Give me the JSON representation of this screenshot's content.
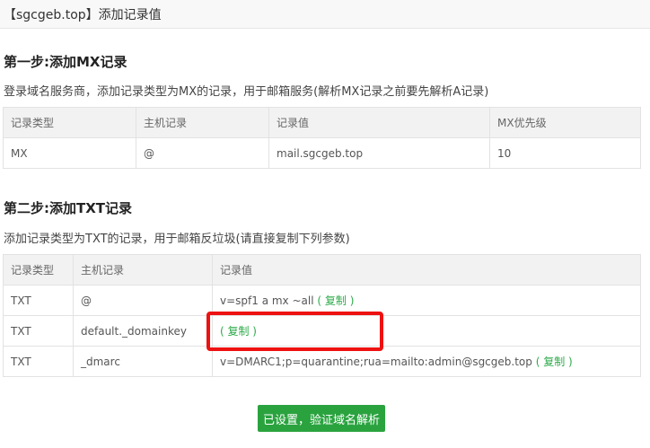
{
  "header": {
    "title": "【sgcgeb.top】添加记录值"
  },
  "step1": {
    "heading": "第一步:添加MX记录",
    "description": "登录域名服务商，添加记录类型为MX的记录，用于邮箱服务(解析MX记录之前要先解析A记录)",
    "columns": [
      "记录类型",
      "主机记录",
      "记录值",
      "MX优先级"
    ],
    "rows": [
      {
        "type": "MX",
        "host": "@",
        "value": "mail.sgcgeb.top",
        "priority": "10"
      }
    ]
  },
  "step2": {
    "heading": "第二步:添加TXT记录",
    "description": "添加记录类型为TXT的记录，用于邮箱反垃圾(请直接复制下列参数)",
    "columns": [
      "记录类型",
      "主机记录",
      "记录值"
    ],
    "rows": [
      {
        "type": "TXT",
        "host": "@",
        "value": "v=spf1 a mx ~all",
        "copy": "( 复制 )"
      },
      {
        "type": "TXT",
        "host": "default._domainkey",
        "value": "",
        "copy": "( 复制 )"
      },
      {
        "type": "TXT",
        "host": "_dmarc",
        "value": "v=DMARC1;p=quarantine;rua=mailto:admin@sgcgeb.top",
        "copy": "( 复制 )"
      }
    ]
  },
  "actions": {
    "verify_label": "已设置，验证域名解析"
  },
  "colors": {
    "accent_green": "#2aa33f",
    "copy_link_green": "#2eaa4a",
    "highlight_red": "#ee1111"
  }
}
